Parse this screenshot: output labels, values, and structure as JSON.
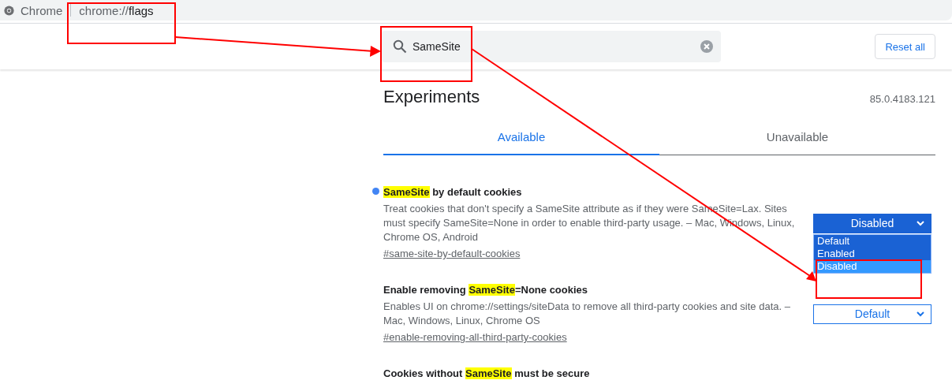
{
  "address_bar": {
    "app_name": "Chrome",
    "url_scheme": "chrome://",
    "url_path": "flags"
  },
  "search": {
    "value": "SameSite"
  },
  "reset_button": "Reset all",
  "title": "Experiments",
  "version": "85.0.4183.121",
  "tabs": [
    {
      "label": "Available",
      "selected": true
    },
    {
      "label": "Unavailable",
      "selected": false
    }
  ],
  "flags": [
    {
      "modified": true,
      "name_parts": [
        {
          "text": "SameSite",
          "highlighted": true
        },
        {
          "text": " by default cookies",
          "highlighted": false
        }
      ],
      "description": "Treat cookies that don't specify a SameSite attribute as if they were SameSite=Lax. Sites must specify SameSite=None in order to enable third-party usage. – Mac, Windows, Linux, Chrome OS, Android",
      "link": "#same-site-by-default-cookies",
      "select": {
        "value": "Disabled",
        "open": true,
        "options": [
          {
            "label": "Default",
            "selected": false
          },
          {
            "label": "Enabled",
            "selected": false
          },
          {
            "label": "Disabled",
            "selected": true
          }
        ]
      }
    },
    {
      "modified": false,
      "name_parts": [
        {
          "text": "Enable removing ",
          "highlighted": false
        },
        {
          "text": "SameSite",
          "highlighted": true
        },
        {
          "text": "=None cookies",
          "highlighted": false
        }
      ],
      "description": "Enables UI on chrome://settings/siteData to remove all third-party cookies and site data. – Mac, Windows, Linux, Chrome OS",
      "link": "#enable-removing-all-third-party-cookies",
      "select": {
        "value": "Default",
        "open": false
      }
    },
    {
      "modified": false,
      "name_parts": [
        {
          "text": "Cookies without ",
          "highlighted": false
        },
        {
          "text": "SameSite",
          "highlighted": true
        },
        {
          "text": " must be secure",
          "highlighted": false
        }
      ]
    }
  ]
}
